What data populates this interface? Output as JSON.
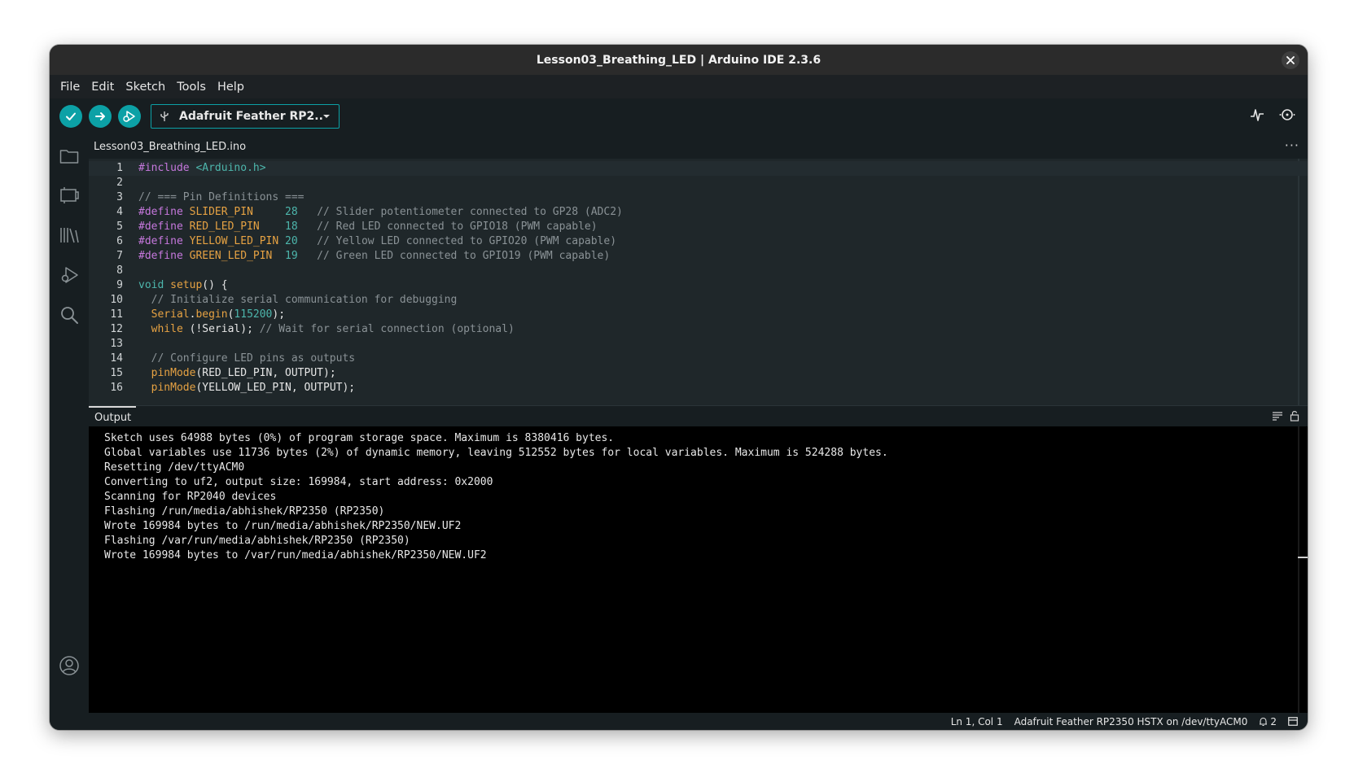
{
  "window": {
    "title": "Lesson03_Breathing_LED | Arduino IDE 2.3.6"
  },
  "menu": [
    "File",
    "Edit",
    "Sketch",
    "Tools",
    "Help"
  ],
  "toolbar": {
    "board_label": "Adafruit Feather RP2..."
  },
  "editor": {
    "tab_label": "Lesson03_Breathing_LED.ino",
    "lines": [
      {
        "n": "1",
        "t": [
          [
            "pre",
            "#include "
          ],
          [
            "inc",
            "<Arduino.h>"
          ]
        ]
      },
      {
        "n": "2",
        "t": []
      },
      {
        "n": "3",
        "t": [
          [
            "com",
            "// === Pin Definitions ==="
          ]
        ]
      },
      {
        "n": "4",
        "t": [
          [
            "pre",
            "#define "
          ],
          [
            "mac",
            "SLIDER_PIN"
          ],
          [
            "plain",
            "     "
          ],
          [
            "num",
            "28"
          ],
          [
            "plain",
            "   "
          ],
          [
            "com",
            "// Slider potentiometer connected to GP28 (ADC2)"
          ]
        ]
      },
      {
        "n": "5",
        "t": [
          [
            "pre",
            "#define "
          ],
          [
            "mac",
            "RED_LED_PIN"
          ],
          [
            "plain",
            "    "
          ],
          [
            "num",
            "18"
          ],
          [
            "plain",
            "   "
          ],
          [
            "com",
            "// Red LED connected to GPIO18 (PWM capable)"
          ]
        ]
      },
      {
        "n": "6",
        "t": [
          [
            "pre",
            "#define "
          ],
          [
            "mac",
            "YELLOW_LED_PIN"
          ],
          [
            "plain",
            " "
          ],
          [
            "num",
            "20"
          ],
          [
            "plain",
            "   "
          ],
          [
            "com",
            "// Yellow LED connected to GPIO20 (PWM capable)"
          ]
        ]
      },
      {
        "n": "7",
        "t": [
          [
            "pre",
            "#define "
          ],
          [
            "mac",
            "GREEN_LED_PIN"
          ],
          [
            "plain",
            "  "
          ],
          [
            "num",
            "19"
          ],
          [
            "plain",
            "   "
          ],
          [
            "com",
            "// Green LED connected to GPIO19 (PWM capable)"
          ]
        ]
      },
      {
        "n": "8",
        "t": []
      },
      {
        "n": "9",
        "t": [
          [
            "kw",
            "void "
          ],
          [
            "fn",
            "setup"
          ],
          [
            "plain",
            "() {"
          ]
        ]
      },
      {
        "n": "10",
        "t": [
          [
            "plain",
            "  "
          ],
          [
            "com",
            "// Initialize serial communication for debugging"
          ]
        ]
      },
      {
        "n": "11",
        "t": [
          [
            "plain",
            "  "
          ],
          [
            "fn",
            "Serial"
          ],
          [
            "plain",
            "."
          ],
          [
            "fn",
            "begin"
          ],
          [
            "plain",
            "("
          ],
          [
            "num",
            "115200"
          ],
          [
            "plain",
            ");"
          ]
        ]
      },
      {
        "n": "12",
        "t": [
          [
            "plain",
            "  "
          ],
          [
            "kw2",
            "while"
          ],
          [
            "plain",
            " (!Serial); "
          ],
          [
            "com",
            "// Wait for serial connection (optional)"
          ]
        ]
      },
      {
        "n": "13",
        "t": []
      },
      {
        "n": "14",
        "t": [
          [
            "plain",
            "  "
          ],
          [
            "com",
            "// Configure LED pins as outputs"
          ]
        ]
      },
      {
        "n": "15",
        "t": [
          [
            "plain",
            "  "
          ],
          [
            "fn",
            "pinMode"
          ],
          [
            "plain",
            "(RED_LED_PIN, OUTPUT);"
          ]
        ]
      },
      {
        "n": "16",
        "t": [
          [
            "plain",
            "  "
          ],
          [
            "fn",
            "pinMode"
          ],
          [
            "plain",
            "(YELLOW_LED_PIN, OUTPUT);"
          ]
        ]
      }
    ]
  },
  "output": {
    "label": "Output",
    "lines": [
      "Sketch uses 64988 bytes (0%) of program storage space. Maximum is 8380416 bytes.",
      "Global variables use 11736 bytes (2%) of dynamic memory, leaving 512552 bytes for local variables. Maximum is 524288 bytes.",
      "Resetting /dev/ttyACM0",
      "Converting to uf2, output size: 169984, start address: 0x2000",
      "Scanning for RP2040 devices",
      "Flashing /run/media/abhishek/RP2350 (RP2350)",
      "Wrote 169984 bytes to /run/media/abhishek/RP2350/NEW.UF2",
      "Flashing /var/run/media/abhishek/RP2350 (RP2350)",
      "Wrote 169984 bytes to /var/run/media/abhishek/RP2350/NEW.UF2"
    ]
  },
  "status": {
    "cursor": "Ln 1, Col 1",
    "board_port": "Adafruit Feather RP2350 HSTX on /dev/ttyACM0",
    "notifications": "2"
  },
  "colors": {
    "accent": "#0ca1a6",
    "bg": "#1f272a",
    "panel": "#171e21"
  }
}
